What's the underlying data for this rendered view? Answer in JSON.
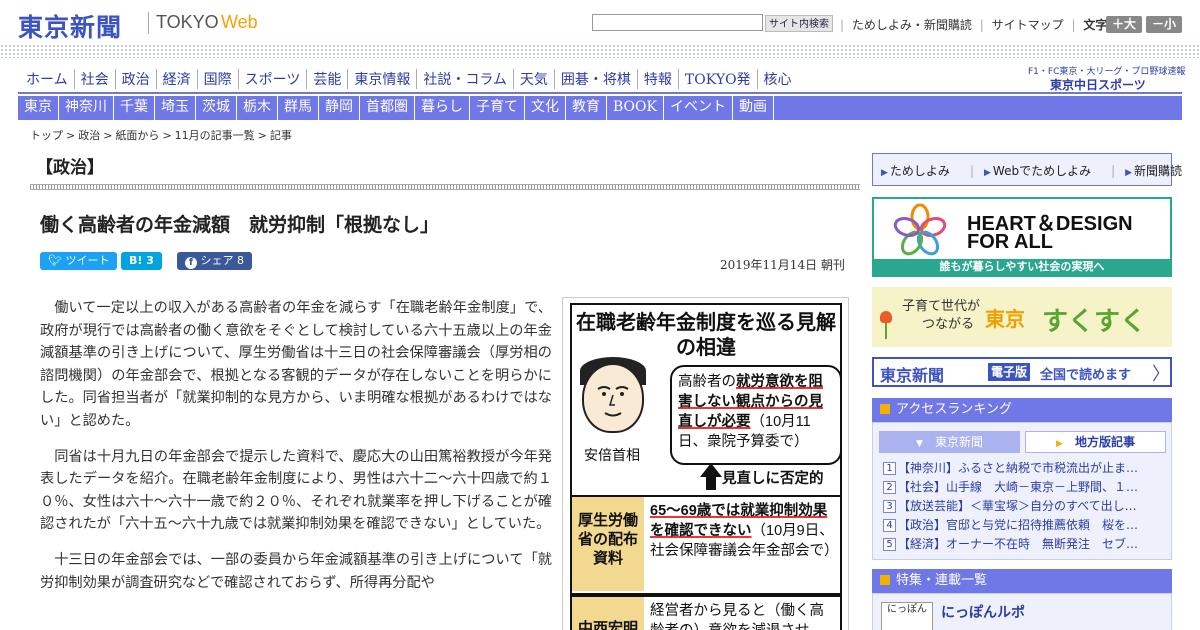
{
  "site": {
    "logo_jp": "東京新聞",
    "logo_tokyo": "TOKYO",
    "logo_web": "Web"
  },
  "header": {
    "search_placeholder": "",
    "search_button": "サイト内検索",
    "links": [
      "ためしよみ・新聞購読",
      "サイトマップ"
    ],
    "font_label": "文字（0）",
    "font_bigger": "＋大",
    "font_smaller": "－小"
  },
  "nav_main": [
    "ホーム",
    "社会",
    "政治",
    "経済",
    "国際",
    "スポーツ",
    "芸能",
    "東京情報",
    "社説・コラム",
    "天気",
    "囲碁・将棋",
    "特報",
    "TOKYO発",
    "核心"
  ],
  "sports_link": {
    "line1": "F1・FC東京・大リーグ・プロ野球速報",
    "line2": "東京中日スポーツ"
  },
  "nav_region": [
    "東京",
    "神奈川",
    "千葉",
    "埼玉",
    "茨城",
    "栃木",
    "群馬",
    "静岡",
    "首都圏",
    "暮らし",
    "子育て",
    "文化",
    "教育",
    "BOOK",
    "イベント",
    "動画"
  ],
  "breadcrumb": [
    "トップ",
    ">",
    "政治",
    ">",
    "紙面から",
    ">",
    "11月の記事一覧",
    ">",
    "記事"
  ],
  "section_title": "【政治】",
  "article": {
    "headline": "働く高齢者の年金減額　就労抑制「根拠なし」",
    "tweet": "ツイート",
    "hatena": "B! 3",
    "share": "シェア 8",
    "date": "2019年11月14日 朝刊",
    "paragraphs": [
      "働いて一定以上の収入がある高齢者の年金を減らす「在職老齢年金制度」で、政府が現行では高齢者の働く意欲をそぐとして検討している六十五歳以上の年金減額基準の引き上げについて、厚生労働省は十三日の社会保障審議会（厚労相の諮問機関）の年金部会で、根拠となる客観的データが存在しないことを明らかにした。同省担当者が「就業抑制的な見方から、いま明確な根拠があるわけではない」と認めた。",
      "同省は十月九日の年金部会で提示した資料で、慶応大の山田篤裕教授が今年発表したデータを紹介。在職老齢年金制度により、男性は六十二～六十四歳で約１０％、女性は六十～六十一歳で約２０％、それぞれ就業率を押し下げることが確認されたが「六十五～六十九歳では就業抑制効果を確認できない」としていた。",
      "十三日の年金部会では、一部の委員から年金減額基準の引き上げについて「就労抑制効果が調査研究などで確認されておらず、所得再分配や"
    ]
  },
  "figure": {
    "title": "在職老齢年金制度を巡る見解の相違",
    "pm_label": "安倍首相",
    "bubble_pre": "高齢者の",
    "bubble_u": "就労意欲を阻害しない観点からの見直しが必要",
    "bubble_post": "（10月11日、衆院予算委で）",
    "arrow_text": "見直しに否定的",
    "rows": [
      {
        "head": "厚生労働省の配布資料",
        "u": "65～69歳では就業抑制効果を確認できない",
        "rest": "（10月9日、社会保障審議会年金部会で）"
      },
      {
        "head": "中西宏明",
        "u": "",
        "rest": "経営者から見ると（働く高齢者の）意欲を減退させ"
      }
    ]
  },
  "sidebar": {
    "tabs": [
      "ためしよみ",
      "Webでためしよみ",
      "新聞購読"
    ],
    "hd_banner": {
      "line1": "HEART＆DESIGN",
      "line2": "FOR ALL",
      "strip": "誰もが暮らしやすい社会の実現へ"
    },
    "sk_banner": {
      "small1": "子育て世代が",
      "small2": "つながる",
      "tokyo": "東京",
      "big": "すくすく"
    },
    "ed_banner": {
      "logo": "東京新聞",
      "badge": "電子版",
      "text": "全国で読めます",
      "arrow": "〉"
    },
    "ranking": {
      "title": "アクセスランキング",
      "tab1": "東京新聞",
      "tab2": "地方版記事",
      "items": [
        {
          "num": "1",
          "text": "【神奈川】ふるさと納税で市税流出が止ま…"
        },
        {
          "num": "2",
          "text": "【社会】山手線　大崎－東京－上野間、１…"
        },
        {
          "num": "3",
          "text": "【放送芸能】＜華宝塚＞自分のすべて出し…"
        },
        {
          "num": "4",
          "text": "【政治】官邸と与党に招待推薦依頼　桜を…"
        },
        {
          "num": "5",
          "text": "【経済】オーナー不在時　無断発注　セブ…"
        }
      ]
    },
    "special": {
      "title": "特集・連載一覧",
      "thumb": "にっぽん",
      "item": "にっぽんルポ"
    }
  },
  "colors": {
    "brand": "#3c53c2",
    "nav_bg": "#7077e6",
    "accent": "#f5a300",
    "hd_green": "#2aa78f"
  }
}
